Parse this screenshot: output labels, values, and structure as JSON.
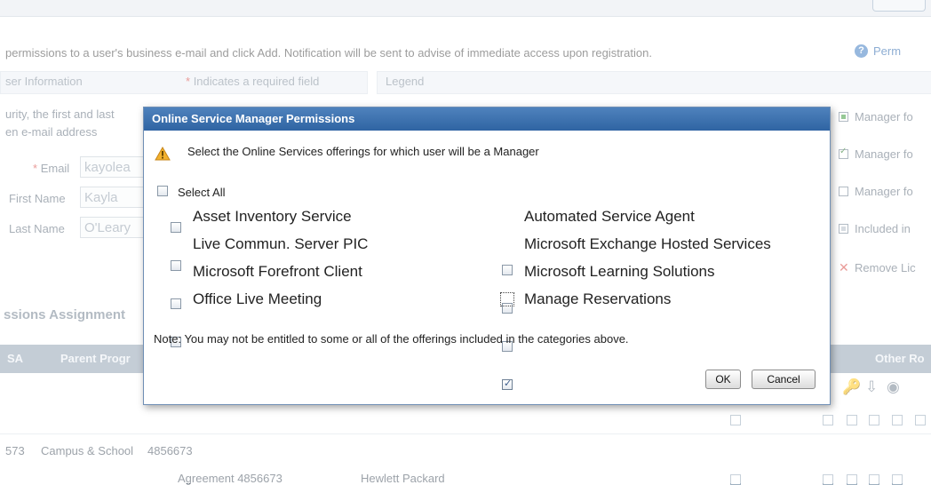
{
  "background": {
    "intro_text": "permissions to a user's business e-mail and click Add. Notification will be sent to advise of immediate access upon registration.",
    "help_link": "Perm",
    "help_icon": "help-icon",
    "user_info_header": "ser Information",
    "required_note": "Indicates a required field",
    "required_star": "*",
    "legend_header": "Legend",
    "security_text_1": "urity, the first and last",
    "security_text_2": "en e-mail address",
    "fields": {
      "email_label": "Email",
      "email_value": "kayolea",
      "first_name_label": "First Name",
      "first_name_value": "Kayla",
      "last_name_label": "Last Name",
      "last_name_value": "O'Leary"
    },
    "legend_items": [
      "Manager fo",
      "Manager fo",
      "Manager fo",
      "Included in",
      "Remove Lic"
    ],
    "assignments_title": "ssions Assignment",
    "grid_headers": {
      "col1": "SA",
      "col2": "Parent Progr",
      "col_right": "Other Ro"
    },
    "row1": {
      "id": "573",
      "program": "Campus & School",
      "agreement": "4856673"
    },
    "row2": {
      "agreement_name": "Agreement 4856673",
      "company": "Hewlett Packard"
    }
  },
  "dialog": {
    "title": "Online Service Manager Permissions",
    "instruction": "Select the Online Services offerings for which user will be a Manager",
    "select_all_label": "Select All",
    "services_left": [
      {
        "label": "Asset Inventory Service",
        "checked": false
      },
      {
        "label": "Live Commun. Server PIC",
        "checked": false
      },
      {
        "label": "Microsoft Forefront Client",
        "checked": false
      },
      {
        "label": "Office Live Meeting",
        "checked": false
      }
    ],
    "services_right": [
      {
        "label": "Automated Service Agent",
        "checked": false
      },
      {
        "label": "Microsoft Exchange Hosted Services",
        "checked": false
      },
      {
        "label": "Microsoft Learning Solutions",
        "checked": false
      },
      {
        "label": "Manage Reservations",
        "checked": true
      }
    ],
    "note": "Note: You may not be entitled to some or all of the offerings included in the categories above.",
    "ok_label": "OK",
    "cancel_label": "Cancel"
  }
}
